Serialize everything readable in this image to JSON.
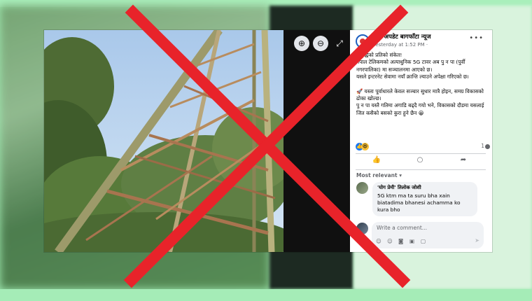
{
  "post": {
    "page_name": "मेची अपडेट बागफाँटा न्यूज",
    "timestamp": "Yesterday at 1:52 PM · ",
    "body": [
      "समृद्धिको प्रतिको संकेत!",
      "नेपाल टेलिकमको अत्याधुनिक 5G टावर अब पु न पा (पुर्वी नगरपालिका) मा सञ्चालनमा आएको छ।",
      "यसले इन्टरनेट सेवामा नयाँ क्रान्ति ल्याउने अपेक्षा गरिएको छ।",
      "",
      "🚀 यस्ता पूर्वाधारले केवल सञ्चार सुधार मात्रै होइन, समग्र विकासको ढोका खोल्छ।",
      "पु न पा यस्तै गतिमा अगाडि बढ्दै गयो भने, विकासको दौडमा यसलाई जित कसैको बसको कुरा हुने छैन 😀"
    ],
    "comment_count": "1",
    "sort_label": "Most relevant ▾",
    "comment": {
      "author": "'योग प्रेमी' तिलोक जोशी",
      "text": "5G ktm ma ta suru bha xain biatadima bhanesi achamma ko kura bho"
    },
    "write_placeholder": "Write a comment..."
  },
  "icons": {
    "zoom_in": "zoom-in-icon",
    "zoom_out": "zoom-out-icon",
    "expand": "expand-icon",
    "more": "more-options-icon",
    "like": "like-icon",
    "comment": "comment-icon",
    "share": "share-icon",
    "send": "send-icon"
  },
  "colors": {
    "overlay_x": "#e8232a",
    "page_bg": "#9ee8b0",
    "fb_blue": "#1877f2"
  }
}
